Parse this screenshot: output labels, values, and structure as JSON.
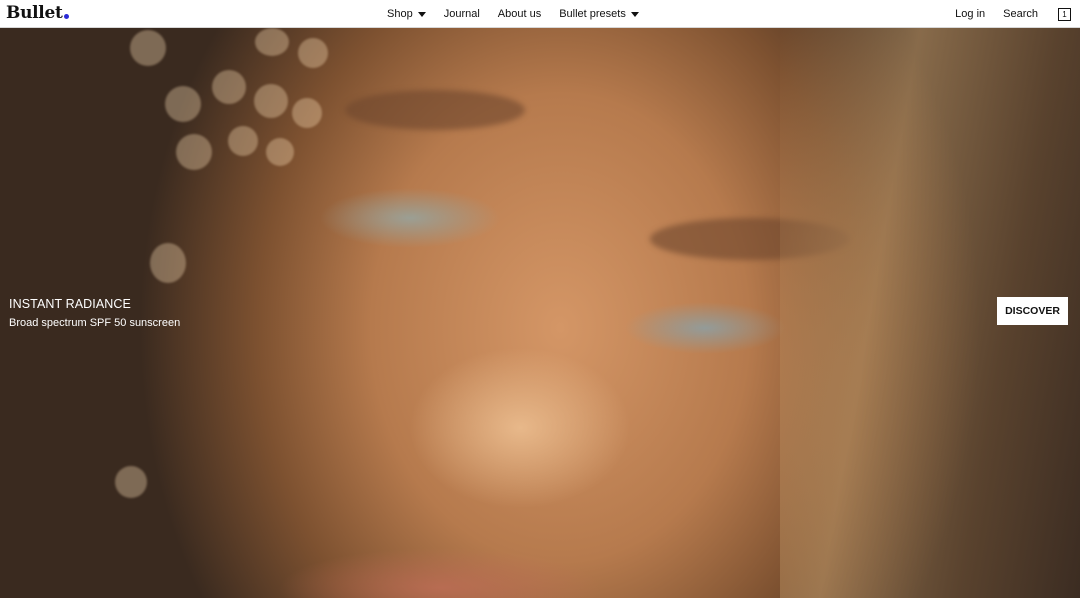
{
  "header": {
    "logo": "Bullet",
    "nav": [
      {
        "label": "Shop",
        "dropdown": true
      },
      {
        "label": "Journal",
        "dropdown": false
      },
      {
        "label": "About us",
        "dropdown": false
      },
      {
        "label": "Bullet presets",
        "dropdown": true
      }
    ],
    "login_label": "Log in",
    "search_label": "Search",
    "cart_count": "1"
  },
  "hero": {
    "title": "INSTANT RADIANCE",
    "subtitle": "Broad spectrum SPF 50 sunscreen",
    "cta_label": "DISCOVER"
  },
  "colors": {
    "logo_dot": "#2b2bd6",
    "header_bg": "#ffffff",
    "text_dark": "#111111",
    "hero_text": "#ffffff"
  },
  "icons": [
    "chevron-down-icon",
    "cart-icon"
  ]
}
